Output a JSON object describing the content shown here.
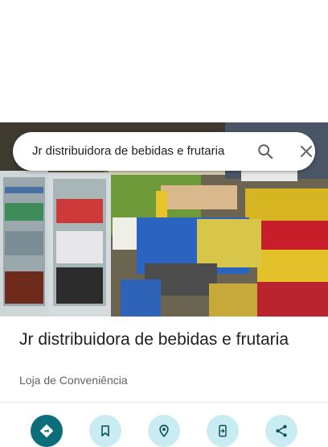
{
  "search": {
    "query": "Jr distribuidora de bebidas e frutaria"
  },
  "place": {
    "name": "Jr distribuidora de bebidas e frutaria",
    "category": "Loja de Conveniência"
  },
  "icons": {
    "search": "search-icon",
    "close": "close-icon",
    "directions": "directions-icon",
    "save": "bookmark-icon",
    "nearby": "nearby-icon",
    "send_to_phone": "send-to-phone-icon",
    "share": "share-icon"
  },
  "colors": {
    "primary_action": "#0b6e7a",
    "secondary_action": "#c9ecf3",
    "title_text": "#202124",
    "subtitle_text": "#5f6368"
  }
}
